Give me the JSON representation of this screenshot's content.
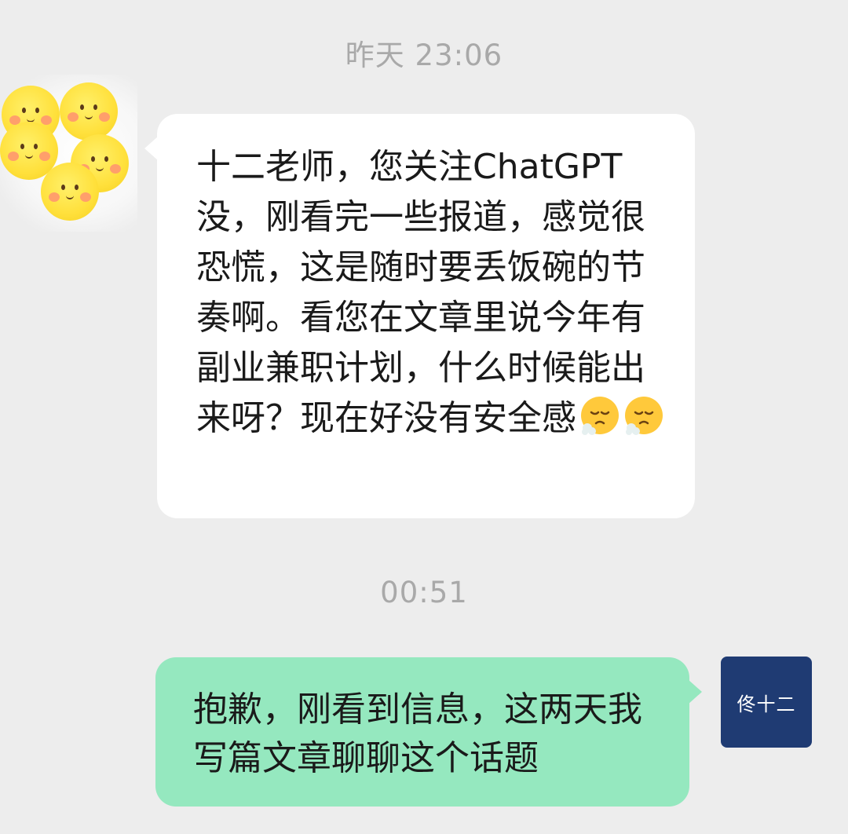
{
  "chat": {
    "timestamps": [
      "昨天 23:06",
      "00:51"
    ],
    "incoming": {
      "text": "十二老师，您关注ChatGPT没，刚看完一些报道，感觉很恐慌，这是随时要丢饭碗的节奏啊。看您在文章里说今年有副业兼职计划，什么时候能出来呀？现在好没有安全感",
      "emojis": [
        "sighing-face-icon",
        "sighing-face-icon"
      ]
    },
    "outgoing": {
      "text": "抱歉，刚看到信息，这两天我写篇文章聊聊这个话题",
      "avatar_text": "佟十二"
    }
  },
  "colors": {
    "background": "#ededed",
    "incoming_bubble": "#ffffff",
    "outgoing_bubble": "#95e8bf",
    "timestamp": "#a9a9a9",
    "avatar_out": "#1f3b73"
  }
}
